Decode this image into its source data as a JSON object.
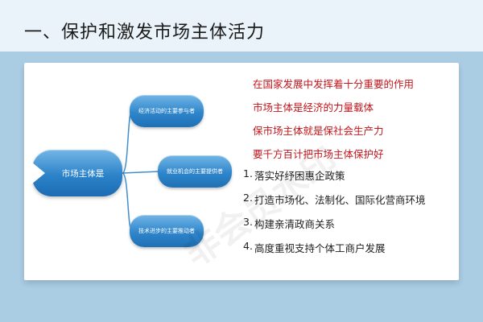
{
  "header": {
    "title": "一、保护和激发市场主体活力"
  },
  "diagram": {
    "root": "市场主体是",
    "children": [
      "经济活动的主要参与者",
      "就业机会的主要提供者",
      "技术进步的主要推动者"
    ],
    "line_color": "#3f8fcf"
  },
  "highlight_lines": [
    "在国家发展中发挥着十分重要的作用",
    "市场主体是经济的力量载体",
    "保市场主体就是保社会生产力",
    "要千方百计把市场主体保护好"
  ],
  "highlight_color": "#c3161c",
  "measures": [
    {
      "num": "1.",
      "text": "落实好纾困惠企政策"
    },
    {
      "num": "2.",
      "text": "打造市场化、法制化、国际化营商环境"
    },
    {
      "num": "3.",
      "text": "构建亲清政商关系"
    },
    {
      "num": "4.",
      "text": "高度重视支持个体工商户发展"
    }
  ]
}
